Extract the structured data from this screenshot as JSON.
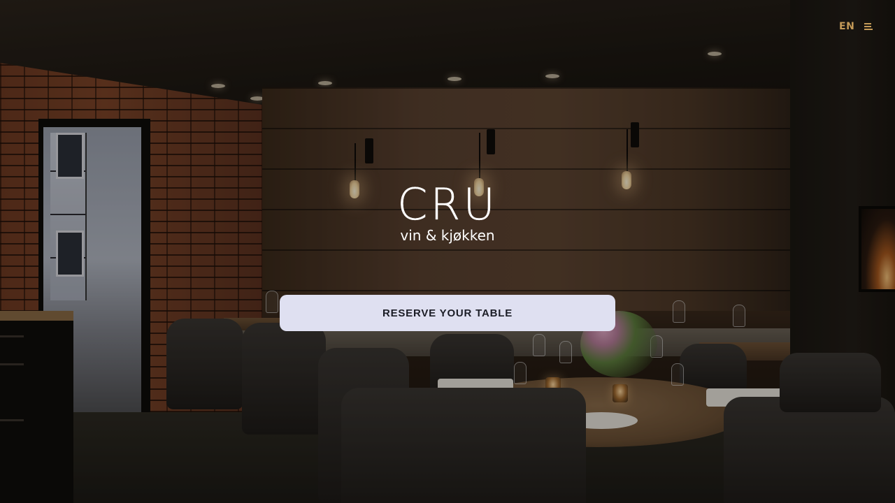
{
  "header": {
    "language_label": "EN",
    "menu_icon": "hamburger-icon"
  },
  "brand": {
    "logo_title": "CRU",
    "logo_subtitle": "vin & kjøkken"
  },
  "hero": {
    "cta_label": "RESERVE YOUR TABLE",
    "background": "restaurant-interior-photo"
  },
  "colors": {
    "accent": "#c49a58",
    "cta_background": "#dfe0f1",
    "cta_text": "#1b1d26",
    "logo": "#ffffff"
  }
}
